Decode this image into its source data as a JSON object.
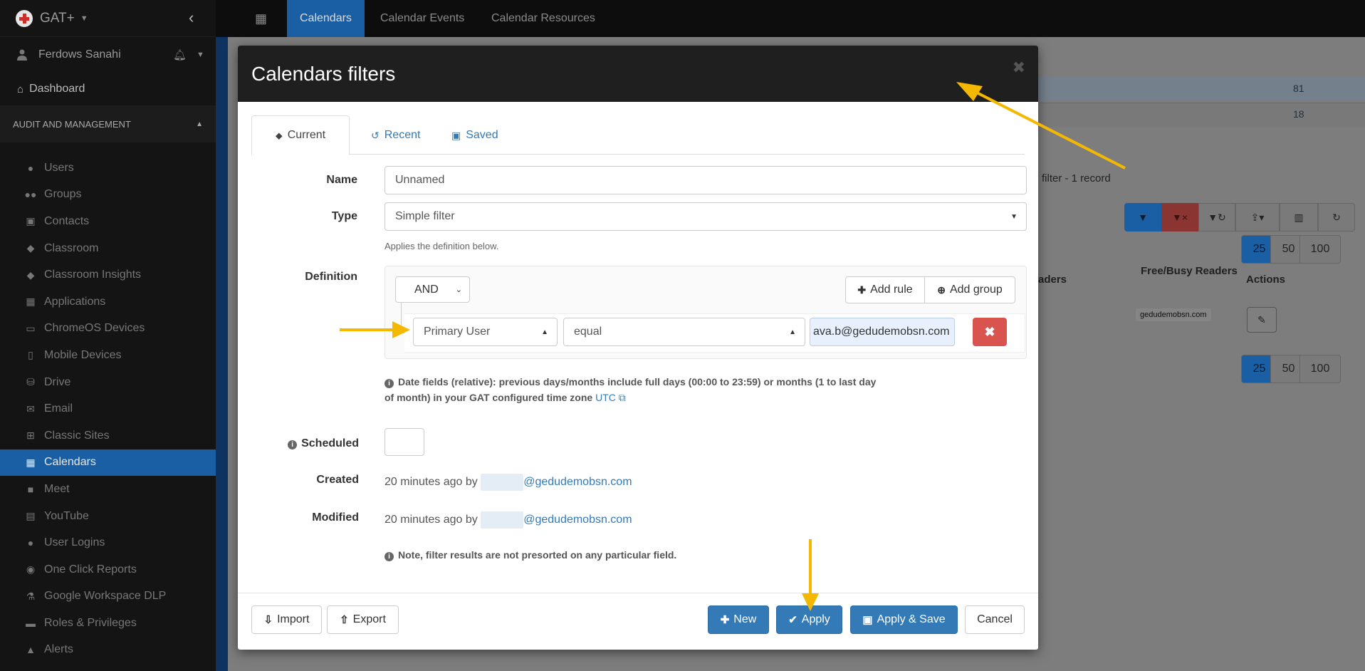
{
  "sidebar": {
    "brand": "GAT+",
    "user_name": "Ferdows Sanahi",
    "dashboard": "Dashboard",
    "section": "AUDIT AND MANAGEMENT",
    "items": [
      {
        "label": "Users",
        "icon": "user-icon"
      },
      {
        "label": "Groups",
        "icon": "groups-icon"
      },
      {
        "label": "Contacts",
        "icon": "contacts-icon"
      },
      {
        "label": "Classroom",
        "icon": "graduation-cap-icon"
      },
      {
        "label": "Classroom Insights",
        "icon": "classroom-insights-icon"
      },
      {
        "label": "Applications",
        "icon": "grid-icon"
      },
      {
        "label": "ChromeOS Devices",
        "icon": "laptop-icon"
      },
      {
        "label": "Mobile Devices",
        "icon": "mobile-icon"
      },
      {
        "label": "Drive",
        "icon": "drive-icon"
      },
      {
        "label": "Email",
        "icon": "envelope-icon"
      },
      {
        "label": "Classic Sites",
        "icon": "sitemap-icon"
      },
      {
        "label": "Calendars",
        "icon": "calendar-icon"
      },
      {
        "label": "Meet",
        "icon": "video-icon"
      },
      {
        "label": "YouTube",
        "icon": "film-icon"
      },
      {
        "label": "User Logins",
        "icon": "globe-icon"
      },
      {
        "label": "One Click Reports",
        "icon": "eye-icon"
      },
      {
        "label": "Google Workspace DLP",
        "icon": "flask-icon"
      },
      {
        "label": "Roles & Privileges",
        "icon": "lock-icon"
      },
      {
        "label": "Alerts",
        "icon": "bell-icon"
      }
    ],
    "active_item": "Calendars"
  },
  "topnav": {
    "tabs": [
      "Calendars",
      "Calendar Events",
      "Calendar Resources"
    ],
    "active_tab": "Calendars"
  },
  "background": {
    "row1_value": "81",
    "row2_value": "18",
    "filter_status": "filter -  1 record",
    "page_sizes": [
      "25",
      "50",
      "100"
    ],
    "col_readers": "aders",
    "col_freebusy": "Free/Busy Readers",
    "col_actions": "Actions",
    "chip": "gedudemobsn.com"
  },
  "modal": {
    "title": "Calendars filters",
    "tabs": [
      {
        "label": "Current",
        "icon": "tag-icon"
      },
      {
        "label": "Recent",
        "icon": "history-icon"
      },
      {
        "label": "Saved",
        "icon": "floppy-icon"
      }
    ],
    "name_label": "Name",
    "name_placeholder": "Unnamed",
    "type_label": "Type",
    "type_value": "Simple filter",
    "type_help": "Applies the definition below.",
    "definition_label": "Definition",
    "condition": "AND",
    "add_rule": "Add rule",
    "add_group": "Add group",
    "rule": {
      "field": "Primary User",
      "operator": "equal",
      "value": "ava.b@gedudemobsn.com"
    },
    "date_note_line1": "Date fields (relative): previous days/months include full days (00:00 to 23:59) or months (1 to last day",
    "date_note_line2": "of month) in your GAT configured time zone",
    "date_note_link": "UTC",
    "scheduled_label": "Scheduled",
    "created_label": "Created",
    "created_text": "20 minutes ago by",
    "created_domain": "@gedudemobsn.com",
    "modified_label": "Modified",
    "modified_text": "20 minutes ago by",
    "modified_domain": "@gedudemobsn.com",
    "sort_note": "Note, filter results are not presorted on any particular field.",
    "footer": {
      "import": "Import",
      "export": "Export",
      "new": "New",
      "apply": "Apply",
      "apply_save": "Apply & Save",
      "cancel": "Cancel"
    }
  },
  "colors": {
    "primary": "#337ab7",
    "danger": "#d9534f",
    "sidebar_active": "#1a5ea3",
    "annotation_arrow": "#f5b800"
  }
}
